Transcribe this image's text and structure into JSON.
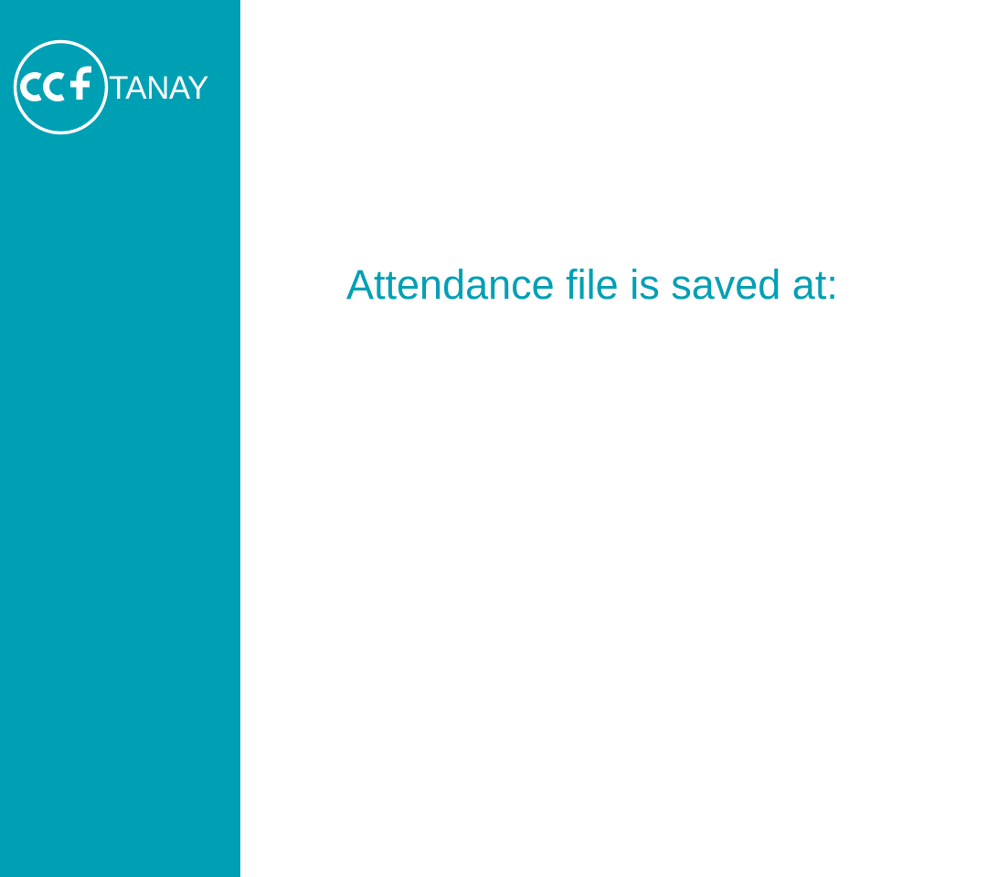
{
  "sidebar": {
    "logo": {
      "mark_text": "ccf",
      "wordmark": "TANAY",
      "icon": "ccf-logo-icon"
    }
  },
  "main": {
    "message": "Attendance file is saved at:"
  },
  "colors": {
    "accent": "#00a0b4",
    "background": "#ffffff",
    "logo": "#ffffff"
  }
}
